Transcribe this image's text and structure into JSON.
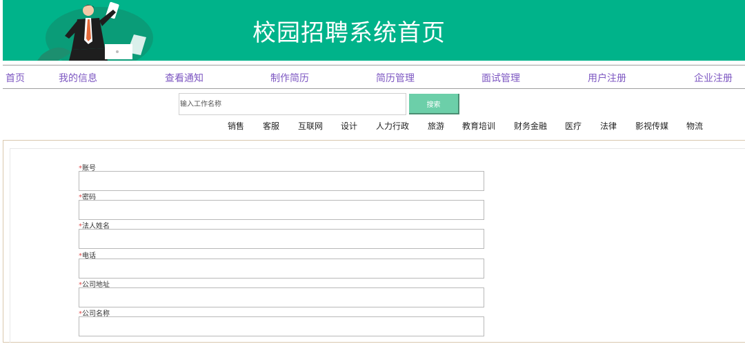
{
  "banner": {
    "title": "校园招聘系统首页"
  },
  "nav": {
    "items": [
      "首页",
      "我的信息",
      "查看通知",
      "制作简历",
      "简历管理",
      "面试管理",
      "用户注册",
      "企业注册"
    ]
  },
  "search": {
    "placeholder": "输入工作名称",
    "button_label": "搜索"
  },
  "categories": [
    "销售",
    "客服",
    "互联网",
    "设计",
    "人力行政",
    "旅游",
    "教育培训",
    "财务金融",
    "医疗",
    "法律",
    "影视传媒",
    "物流"
  ],
  "form": {
    "required_mark": "*",
    "fields": [
      {
        "label": "账号",
        "value": ""
      },
      {
        "label": "密码",
        "value": ""
      },
      {
        "label": "法人姓名",
        "value": ""
      },
      {
        "label": "电话",
        "value": ""
      },
      {
        "label": "公司地址",
        "value": ""
      },
      {
        "label": "公司名称",
        "value": ""
      }
    ]
  },
  "colors": {
    "banner": "#00b38a",
    "nav_link": "#7d57c2",
    "search_button": "#6ccfa9",
    "required": "#e04b4b"
  }
}
